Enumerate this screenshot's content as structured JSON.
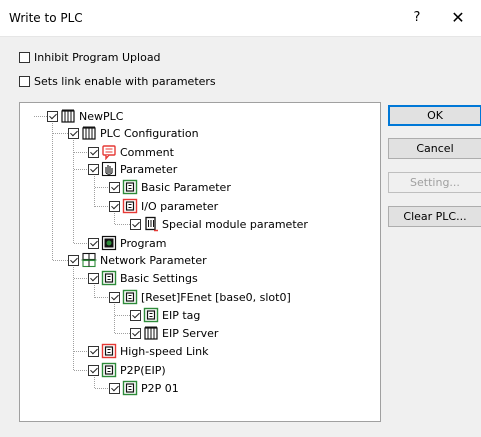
{
  "window": {
    "title": "Write to PLC",
    "help_glyph": "?",
    "close_glyph": "✕"
  },
  "options": {
    "inhibit_upload": {
      "label": "Inhibit Program Upload",
      "checked": false
    },
    "sets_link": {
      "label": "Sets link enable with parameters",
      "checked": false
    }
  },
  "tree": {
    "newplc": "NewPLC",
    "plc_configuration": "PLC Configuration",
    "comment": "Comment",
    "parameter": "Parameter",
    "basic_parameter": "Basic Parameter",
    "io_parameter": "I/O parameter",
    "special_module_parameter": "Special module parameter",
    "program": "Program",
    "network_parameter": "Network Parameter",
    "basic_settings": "Basic Settings",
    "fenet": "[Reset]FEnet [base0, slot0]",
    "eip_tag": "EIP tag",
    "eip_server": "EIP Server",
    "highspeed_link": "High-speed Link",
    "p2p_eip": "P2P(EIP)",
    "p2p_01": "P2P 01"
  },
  "buttons": {
    "ok": "OK",
    "cancel": "Cancel",
    "setting": "Setting...",
    "clear_plc": "Clear PLC..."
  },
  "colors": {
    "default_button_border": "#0078d7",
    "disabled_text": "#a0a0a0",
    "icon_red": "#e53935",
    "icon_green": "#2e8b3a"
  }
}
